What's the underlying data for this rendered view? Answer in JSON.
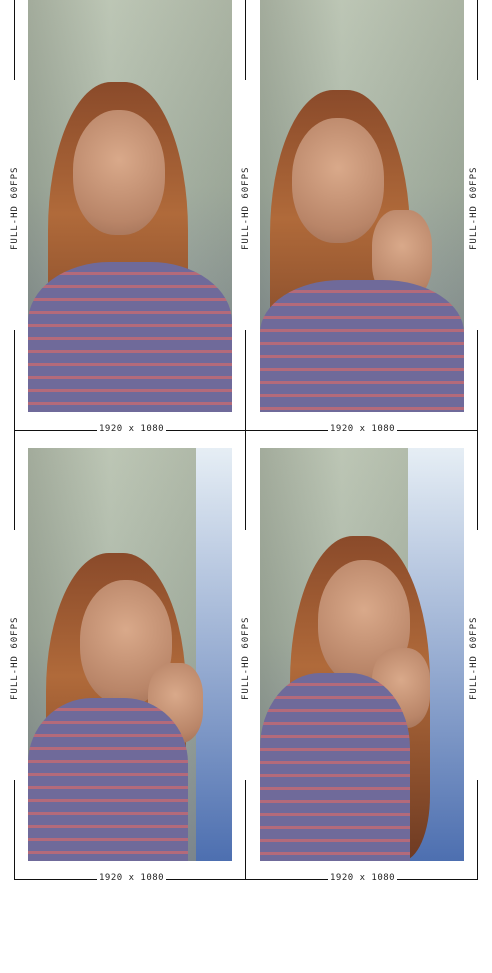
{
  "photos": [
    {
      "side_label_left": "FULL-HD 60FPS",
      "resolution": "1920 x 1080"
    },
    {
      "side_label_left": "FULL-HD 60FPS",
      "side_label_right": "FULL-HD 60FPS",
      "resolution": "1920 x 1080"
    },
    {
      "side_label_left": "FULL-HD 60FPS",
      "resolution": "1920 x 1080"
    },
    {
      "side_label_left": "FULL-HD 60FPS",
      "side_label_right": "FULL-HD 60FPS",
      "resolution": "1920 x 1080"
    }
  ]
}
